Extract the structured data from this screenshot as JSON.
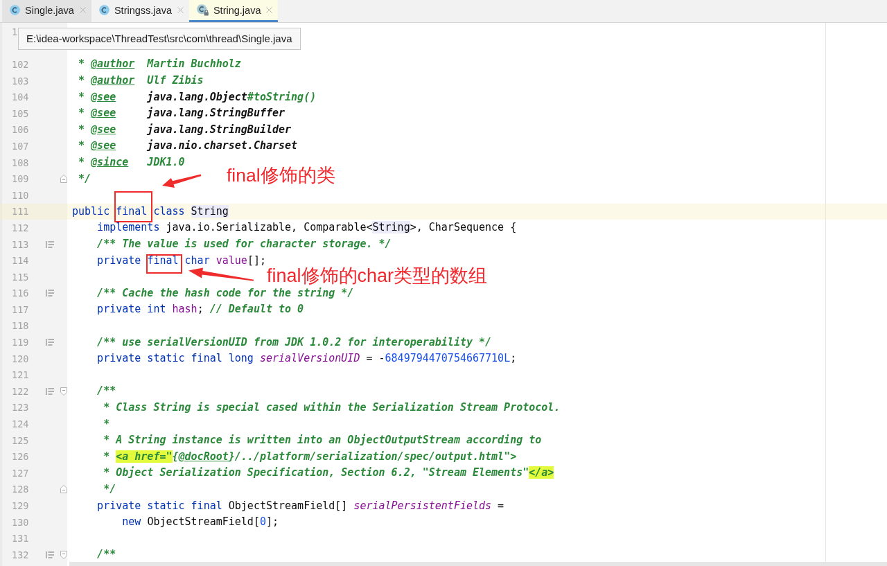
{
  "tabs": [
    {
      "label": "Single.java",
      "selected": false,
      "hovered": true,
      "locked": false
    },
    {
      "label": "Stringss.java",
      "selected": false,
      "hovered": false,
      "locked": false
    },
    {
      "label": "String.java",
      "selected": true,
      "hovered": false,
      "locked": true
    }
  ],
  "tooltip": {
    "text": "E:\\idea-workspace\\ThreadTest\\src\\com\\thread\\Single.java"
  },
  "editor": {
    "lines": [
      {
        "number": "1",
        "current": false
      },
      {
        "number": "102",
        "current": false,
        "tokens": [
          {
            "text": " * ",
            "kind": "doc"
          },
          {
            "text": "@author",
            "kind": "tag"
          },
          {
            "text": "  Martin Buchholz",
            "kind": "doc"
          }
        ]
      },
      {
        "number": "103",
        "current": false,
        "tokens": [
          {
            "text": " * ",
            "kind": "doc"
          },
          {
            "text": "@author",
            "kind": "tag"
          },
          {
            "text": "  Ulf Zibis",
            "kind": "doc"
          }
        ]
      },
      {
        "number": "104",
        "current": false,
        "tokens": [
          {
            "text": " * ",
            "kind": "doc"
          },
          {
            "text": "@see",
            "kind": "tag"
          },
          {
            "text": "     java.lang.Object",
            "kind": "ref"
          },
          {
            "text": "#toString()",
            "kind": "doc"
          }
        ]
      },
      {
        "number": "105",
        "current": false,
        "tokens": [
          {
            "text": " * ",
            "kind": "doc"
          },
          {
            "text": "@see",
            "kind": "tag"
          },
          {
            "text": "     java.lang.StringBuffer",
            "kind": "ref"
          }
        ]
      },
      {
        "number": "106",
        "current": false,
        "tokens": [
          {
            "text": " * ",
            "kind": "doc"
          },
          {
            "text": "@see",
            "kind": "tag"
          },
          {
            "text": "     java.lang.StringBuilder",
            "kind": "ref"
          }
        ]
      },
      {
        "number": "107",
        "current": false,
        "tokens": [
          {
            "text": " * ",
            "kind": "doc"
          },
          {
            "text": "@see",
            "kind": "tag"
          },
          {
            "text": "     java.nio.charset.Charset",
            "kind": "ref"
          }
        ]
      },
      {
        "number": "108",
        "current": false,
        "tokens": [
          {
            "text": " * ",
            "kind": "doc"
          },
          {
            "text": "@since",
            "kind": "tag"
          },
          {
            "text": "   JDK1.0",
            "kind": "doc"
          }
        ]
      },
      {
        "number": "109",
        "current": false,
        "fold_end": true,
        "tokens": [
          {
            "text": " */",
            "kind": "doc"
          }
        ],
        "note": "final修饰的类"
      },
      {
        "number": "110",
        "current": false
      },
      {
        "number": "111",
        "current": true,
        "tokens": [
          {
            "text": "public ",
            "kind": "keyword"
          },
          {
            "text": "final",
            "kind": "keyword",
            "marked": true
          },
          {
            "text": " class ",
            "kind": "keyword"
          },
          {
            "text": "String",
            "kind": "usage"
          }
        ]
      },
      {
        "number": "112",
        "current": false,
        "tokens": [
          {
            "text": "    implements",
            "kind": "keyword"
          },
          {
            "text": " java.io.Serializable, Comparable<",
            "kind": "plain"
          },
          {
            "text": "String",
            "kind": "usage"
          },
          {
            "text": ">, CharSequence {",
            "kind": "plain"
          }
        ]
      },
      {
        "number": "113",
        "current": false,
        "doc_toggle": true,
        "tokens": [
          {
            "text": "    /** The value is used for character storage. */",
            "kind": "doc"
          }
        ]
      },
      {
        "number": "114",
        "current": false,
        "tokens": [
          {
            "text": "    private ",
            "kind": "keyword"
          },
          {
            "text": "final",
            "kind": "keyword",
            "marked": true
          },
          {
            "text": " char ",
            "kind": "keyword"
          },
          {
            "text": "value",
            "kind": "field"
          },
          {
            "text": "[];",
            "kind": "plain"
          }
        ]
      },
      {
        "number": "115",
        "current": false,
        "note": "final修饰的char类型的数组"
      },
      {
        "number": "116",
        "current": false,
        "doc_toggle": true,
        "tokens": [
          {
            "text": "    /** Cache the hash code for the string */",
            "kind": "doc"
          }
        ]
      },
      {
        "number": "117",
        "current": false,
        "tokens": [
          {
            "text": "    private int ",
            "kind": "keyword"
          },
          {
            "text": "hash",
            "kind": "field"
          },
          {
            "text": "; ",
            "kind": "plain"
          },
          {
            "text": "// Default to 0",
            "kind": "comment"
          }
        ]
      },
      {
        "number": "118",
        "current": false
      },
      {
        "number": "119",
        "current": false,
        "doc_toggle": true,
        "tokens": [
          {
            "text": "    /** use serialVersionUID from JDK 1.0.2 for interoperability */",
            "kind": "doc"
          }
        ]
      },
      {
        "number": "120",
        "current": false,
        "tokens": [
          {
            "text": "    private static final long ",
            "kind": "keyword"
          },
          {
            "text": "serialVersionUID",
            "kind": "static_field"
          },
          {
            "text": " = -",
            "kind": "plain"
          },
          {
            "text": "6849794470754667710L",
            "kind": "number"
          },
          {
            "text": ";",
            "kind": "plain"
          }
        ]
      },
      {
        "number": "121",
        "current": false
      },
      {
        "number": "122",
        "current": false,
        "doc_toggle": true,
        "fold_start": true,
        "tokens": [
          {
            "text": "    /**",
            "kind": "doc"
          }
        ]
      },
      {
        "number": "123",
        "current": false,
        "tokens": [
          {
            "text": "     * Class String is special cased within the Serialization Stream Protocol.",
            "kind": "doc"
          }
        ]
      },
      {
        "number": "124",
        "current": false,
        "tokens": [
          {
            "text": "     *",
            "kind": "doc"
          }
        ]
      },
      {
        "number": "125",
        "current": false,
        "tokens": [
          {
            "text": "     * A String instance is written into an ObjectOutputStream according to",
            "kind": "doc"
          }
        ]
      },
      {
        "number": "126",
        "current": false,
        "tokens": [
          {
            "text": "     * ",
            "kind": "doc"
          },
          {
            "text": "<a href=\"",
            "kind": "markup"
          },
          {
            "text": "{",
            "kind": "doc"
          },
          {
            "text": "@docRoot",
            "kind": "tag"
          },
          {
            "text": "}/../platform/serialization/spec/output.html\">",
            "kind": "doc"
          }
        ]
      },
      {
        "number": "127",
        "current": false,
        "tokens": [
          {
            "text": "     * Object Serialization Specification, Section 6.2, \"Stream Elements\"",
            "kind": "doc"
          },
          {
            "text": "</a>",
            "kind": "markup"
          }
        ]
      },
      {
        "number": "128",
        "current": false,
        "fold_end": true,
        "tokens": [
          {
            "text": "     */",
            "kind": "doc"
          }
        ]
      },
      {
        "number": "129",
        "current": false,
        "tokens": [
          {
            "text": "    private static final ",
            "kind": "keyword"
          },
          {
            "text": "ObjectStreamField[] ",
            "kind": "plain"
          },
          {
            "text": "serialPersistentFields",
            "kind": "static_field"
          },
          {
            "text": " =",
            "kind": "plain"
          }
        ]
      },
      {
        "number": "130",
        "current": false,
        "tokens": [
          {
            "text": "        new ",
            "kind": "keyword"
          },
          {
            "text": "ObjectStreamField[",
            "kind": "plain"
          },
          {
            "text": "0",
            "kind": "number"
          },
          {
            "text": "];",
            "kind": "plain"
          }
        ]
      },
      {
        "number": "131",
        "current": false
      },
      {
        "number": "132",
        "current": false,
        "doc_toggle": true,
        "fold_start": true,
        "tokens": [
          {
            "text": "    /**",
            "kind": "doc"
          }
        ]
      }
    ]
  }
}
